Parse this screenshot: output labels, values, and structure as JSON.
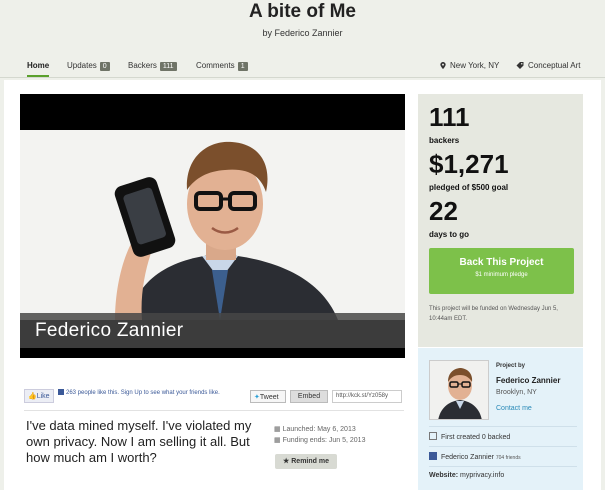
{
  "header": {
    "title": "A bite of Me",
    "byline": "by Federico Zannier"
  },
  "nav": {
    "home": "Home",
    "updates": "Updates",
    "updates_count": "0",
    "backers": "Backers",
    "backers_count": "111",
    "comments": "Comments",
    "comments_count": "1",
    "location": "New York, NY",
    "category": "Conceptual Art"
  },
  "video": {
    "caption": "Federico  Zannier"
  },
  "social": {
    "like_label": "Like",
    "like_text": "263 people like this. Sign Up to see what your friends like.",
    "tweet_label": "Tweet",
    "embed_label": "Embed",
    "short_url": "http://kck.st/Yz058y"
  },
  "description": {
    "blurb": "I've data mined myself. I've violated my own privacy. Now I am selling it all. But how much am I worth?",
    "launched": "Launched: May 6, 2013",
    "funding_ends": "Funding ends: Jun 5, 2013",
    "remind_label": "Remind me"
  },
  "stats": {
    "backers_value": "111",
    "backers_label": "backers",
    "pledged_value": "$1,271",
    "pledged_label": "pledged of $500 goal",
    "days_value": "22",
    "days_label": "days to go",
    "back_button": "Back This Project",
    "min_pledge": "$1 minimum pledge",
    "fund_note": "This project will be funded on Wednesday Jun 5, 10:44am EDT."
  },
  "creator": {
    "project_by": "Project by",
    "name": "Federico Zannier",
    "location": "Brooklyn, NY",
    "contact": "Contact me",
    "first_created": "First created",
    "backed": "0 backed",
    "facebook_name": "Federico Zannier",
    "facebook_friends": "704 friends",
    "website_label": "Website:",
    "website": "myprivacy.info"
  },
  "colors": {
    "accent_green": "#7dc14a",
    "link_blue": "#2a8ab8",
    "count_badge": "#6f7467"
  }
}
